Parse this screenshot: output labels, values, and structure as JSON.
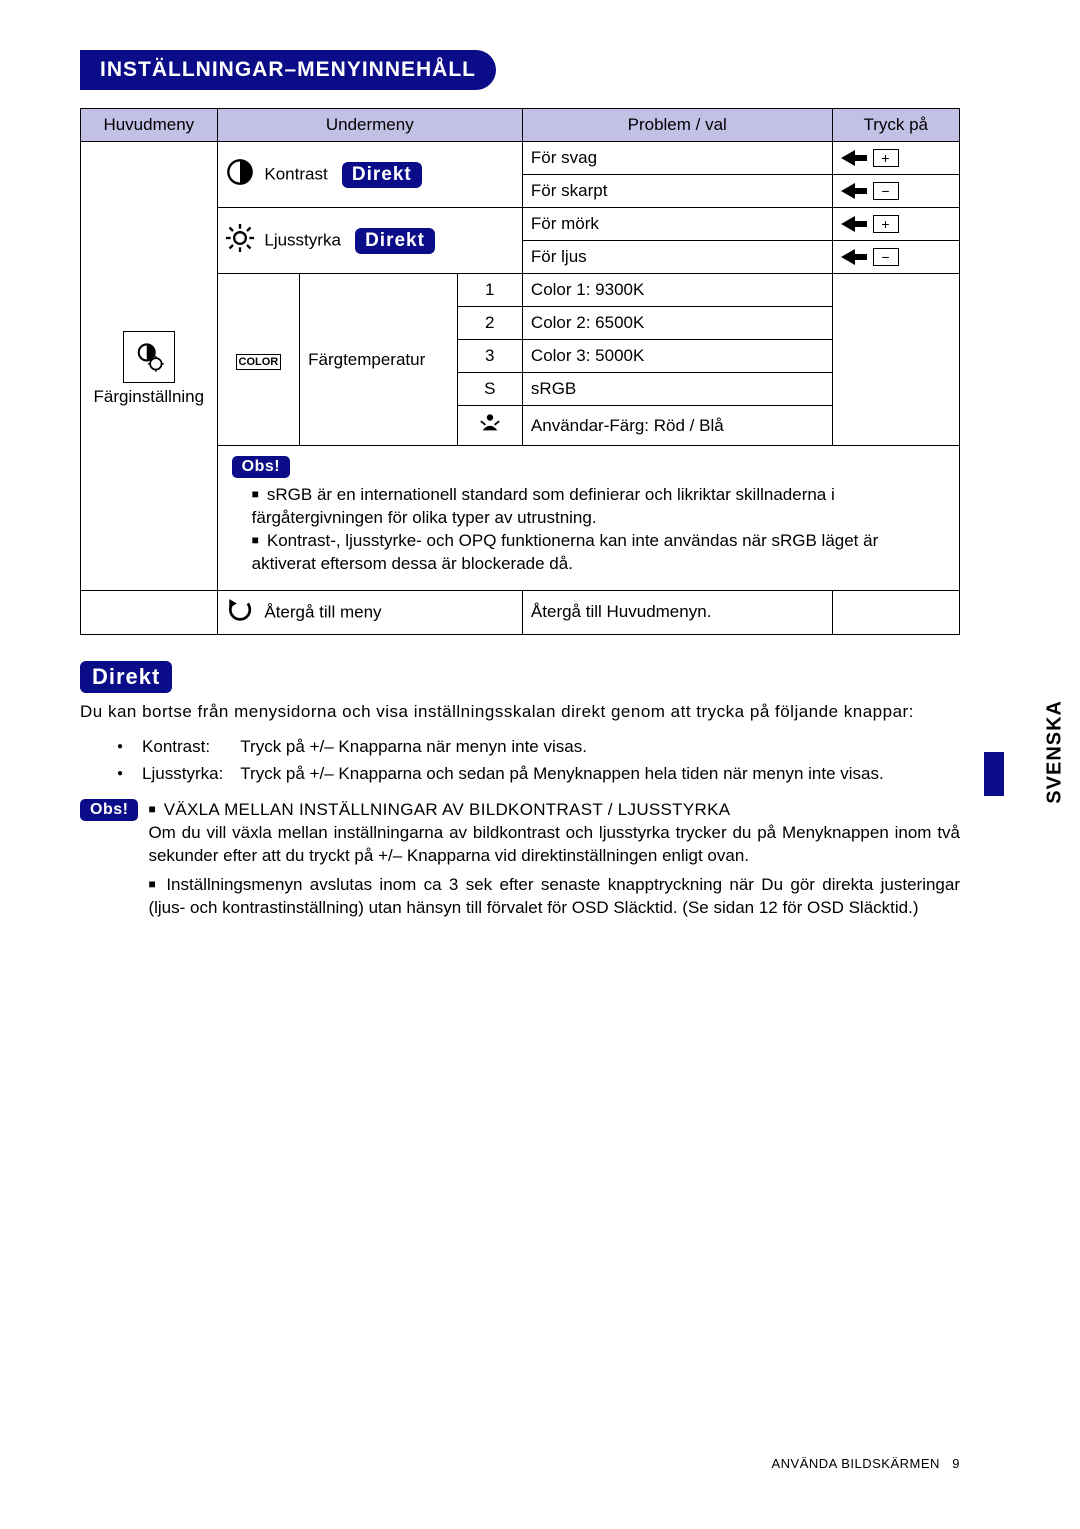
{
  "title": "INSTÄLLNINGAR–MENYINNEHÅLL",
  "headers": {
    "huvudmeny": "Huvudmeny",
    "undermeny": "Undermeny",
    "problem": "Problem / val",
    "tryck": "Tryck på"
  },
  "huvudmeny_label": "Färginställning",
  "submenus": {
    "kontrast": "Kontrast",
    "ljusstyrka": "Ljusstyrka",
    "fargtemperatur": "Färgtemperatur",
    "aterga": "Återgå till meny"
  },
  "direkt_label": "Direkt",
  "problems": {
    "for_svag": "För svag",
    "for_skarpt": "För skarpt",
    "for_mork": "För mörk",
    "for_ljus": "För ljus",
    "color1": "Color 1: 9300K",
    "color2": "Color 2: 6500K",
    "color3": "Color 3: 5000K",
    "srgb": "sRGB",
    "anvfarg": "Användar-Färg: Röd / Blå",
    "aterga_desc": "Återgå till Huvudmenyn."
  },
  "temp_opts": {
    "one": "1",
    "two": "2",
    "three": "3",
    "s": "S"
  },
  "color_badge": "COLOR",
  "obs_label": "Obs!",
  "obs_notes": {
    "srgb": "sRGB är en internationell standard som definierar och likriktar skillnaderna i färgåtergivningen för olika typer av utrustning.",
    "blocked": "Kontrast-, ljusstyrke- och OPQ funktionerna kan inte användas när sRGB läget är aktiverat eftersom dessa är blockerade då."
  },
  "direkt_section": {
    "heading": "Direkt",
    "intro": "Du kan bortse från menysidorna och visa inställningsskalan direkt genom att trycka på följande knappar:",
    "kontrast_label": "Kontrast:",
    "kontrast_text": "Tryck på +/– Knapparna när menyn inte visas.",
    "ljus_label": "Ljusstyrka:",
    "ljus_text": "Tryck på +/– Knapparna och sedan på Menyknappen hela tiden när menyn inte visas."
  },
  "obs2": {
    "switch_title": "VÄXLA MELLAN INSTÄLLNINGAR AV BILDKONTRAST / LJUSSTYRKA",
    "switch_text": "Om du vill växla mellan inställningarna av bildkontrast och ljusstyrka trycker du på Menyknappen inom två sekunder efter att du tryckt på +/– Knapparna vid direktinställningen enligt ovan.",
    "close_text": "Inställningsmenyn avslutas inom ca 3 sek efter senaste knapptryckning när Du gör direkta justeringar (ljus- och kontrastinställning) utan hänsyn till förvalet för OSD Släcktid. (Se sidan 12 för OSD Släcktid.)"
  },
  "side_label": "SVENSKA",
  "footer": {
    "text": "ANVÄNDA BILDSKÄRMEN",
    "page": "9"
  }
}
